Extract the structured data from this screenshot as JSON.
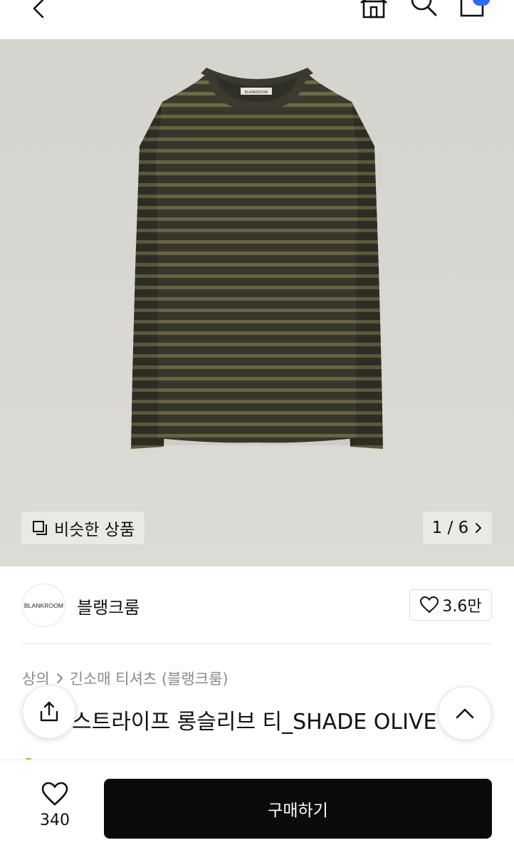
{
  "topbar": {
    "icons": [
      "chevron-left-icon",
      "home-icon",
      "search-icon",
      "cart-icon"
    ],
    "cart_badge_color": "#2f6cf6"
  },
  "gallery": {
    "similar_label": "비슷한 상품",
    "counter": "1 / 6",
    "background_color": "#d8d6d1",
    "tag_text": "BLANKROOM"
  },
  "brand": {
    "logo_text": "BLANKROOM",
    "name": "블랭크룸",
    "like_count": "3.6만"
  },
  "product": {
    "breadcrumb": [
      "상의",
      "긴소매 티셔츠 (블랭크룸)"
    ],
    "title": "스트라이프 롱슬리브 티_SHADE OLIVE"
  },
  "bottom": {
    "wish_count": "340",
    "buy_label": "구매하기"
  }
}
